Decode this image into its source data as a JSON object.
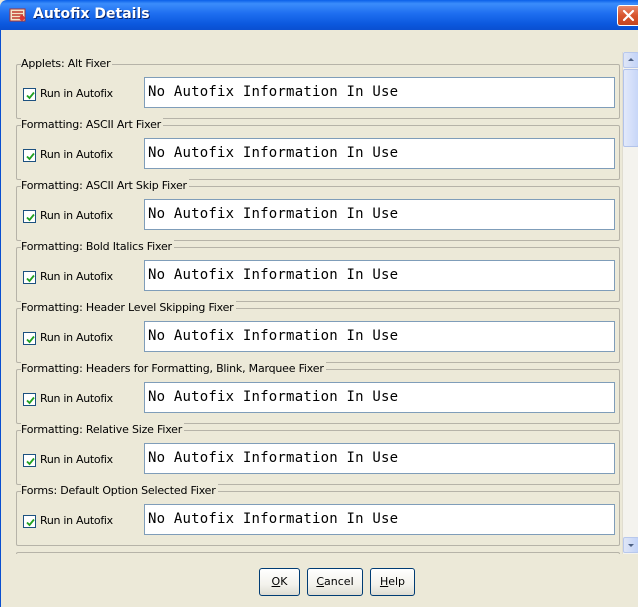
{
  "window": {
    "title": "Autofix Details"
  },
  "fixers": [
    {
      "group_title": "Applets: Alt Fixer",
      "checkbox_label": "Run in Autofix",
      "checked": true,
      "info": "No Autofix Information In Use"
    },
    {
      "group_title": "Formatting: ASCII Art Fixer",
      "checkbox_label": "Run in Autofix",
      "checked": true,
      "info": "No Autofix Information In Use"
    },
    {
      "group_title": "Formatting: ASCII Art Skip Fixer",
      "checkbox_label": "Run in Autofix",
      "checked": true,
      "info": "No Autofix Information In Use"
    },
    {
      "group_title": "Formatting: Bold Italics Fixer",
      "checkbox_label": "Run in Autofix",
      "checked": true,
      "info": "No Autofix Information In Use"
    },
    {
      "group_title": "Formatting: Header Level Skipping Fixer",
      "checkbox_label": "Run in Autofix",
      "checked": true,
      "info": "No Autofix Information In Use"
    },
    {
      "group_title": "Formatting: Headers for Formatting, Blink, Marquee Fixer",
      "checkbox_label": "Run in Autofix",
      "checked": true,
      "info": "No Autofix Information In Use"
    },
    {
      "group_title": "Formatting: Relative Size Fixer",
      "checkbox_label": "Run in Autofix",
      "checked": true,
      "info": "No Autofix Information In Use"
    },
    {
      "group_title": "Forms: Default Option Selected Fixer",
      "checkbox_label": "Run in Autofix",
      "checked": true,
      "info": "No Autofix Information In Use"
    }
  ],
  "buttons": {
    "ok_mnemonic": "O",
    "ok_rest": "K",
    "cancel_mnemonic": "C",
    "cancel_rest": "ancel",
    "help_mnemonic": "H",
    "help_rest": "elp"
  },
  "colors": {
    "titlebar": "#0a5fe8",
    "close_button": "#d8552e",
    "dialog_background": "#ece9d8",
    "field_border": "#7f9db9"
  }
}
